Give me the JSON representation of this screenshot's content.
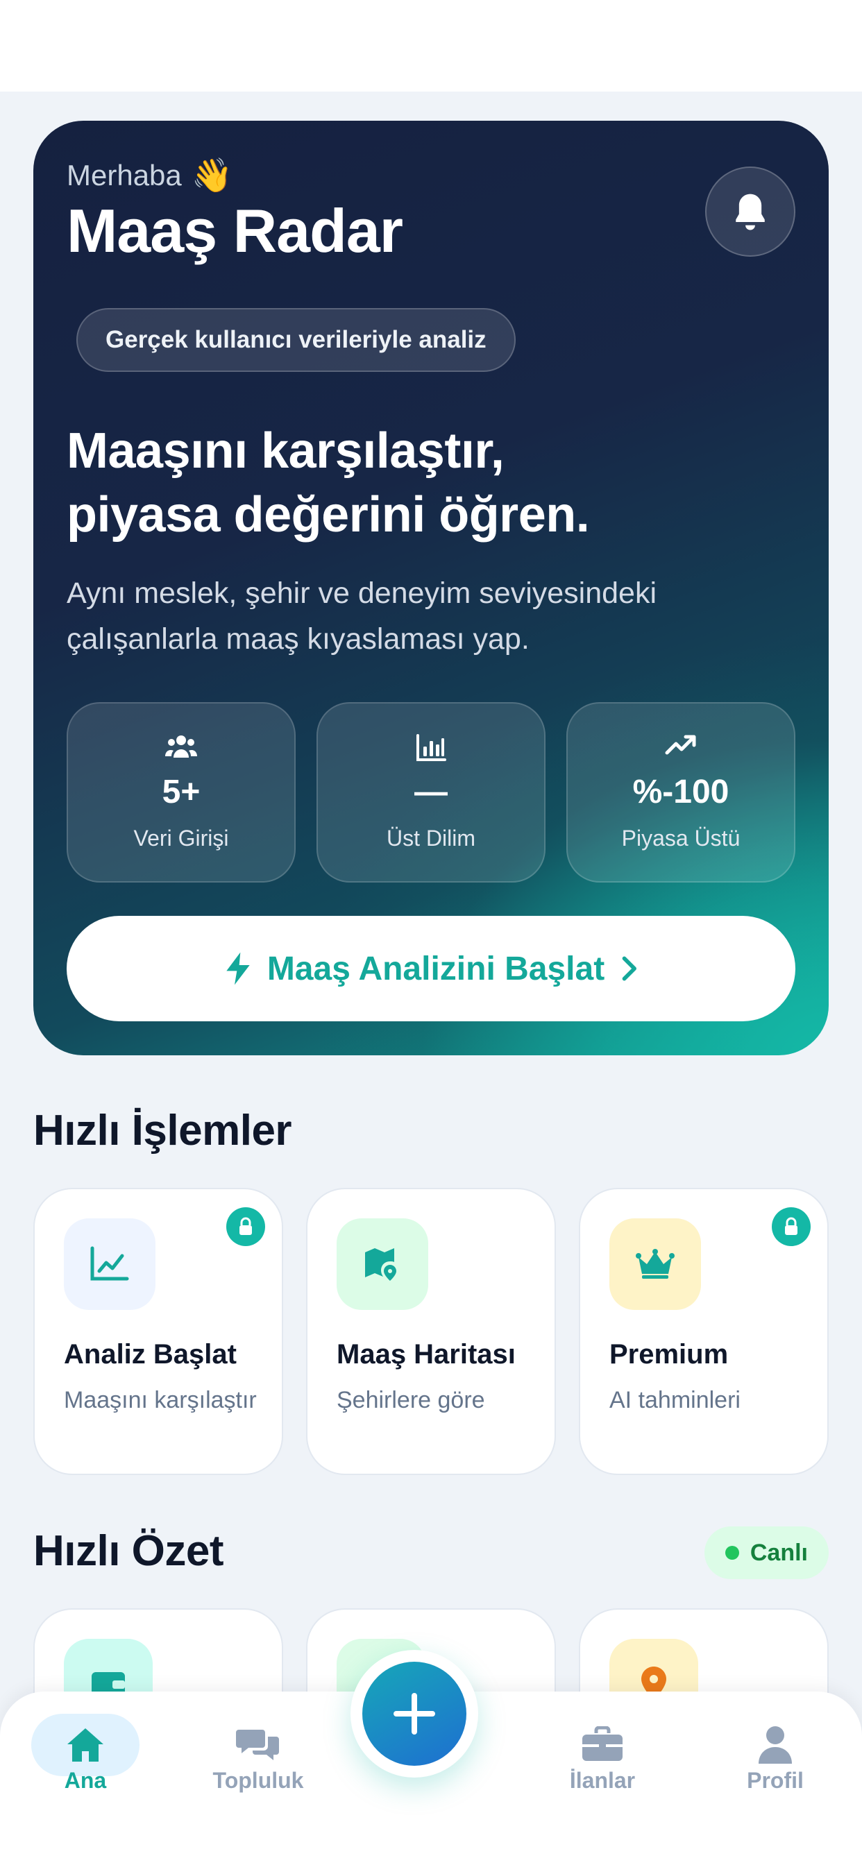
{
  "hero": {
    "greeting": "Merhaba",
    "wave_emoji": "👋",
    "title": "Maaş Radar",
    "badge": "Gerçek kullanıcı verileriyle analiz",
    "headline_line1": "Maaşını karşılaştır,",
    "headline_line2": "piyasa değerini öğren.",
    "subtitle_line1": "Aynı meslek, şehir ve deneyim seviyesindeki",
    "subtitle_line2": "çalışanlarla maaş kıyaslaması yap.",
    "stats": [
      {
        "icon": "users-icon",
        "value": "5+",
        "label": "Veri Girişi"
      },
      {
        "icon": "bar-chart-icon",
        "value": "—",
        "label": "Üst Dilim"
      },
      {
        "icon": "trending-up-icon",
        "value": "%-100",
        "label": "Piyasa Üstü"
      }
    ],
    "cta_label": "Maaş Analizini Başlat"
  },
  "quick_actions": {
    "title": "Hızlı İşlemler",
    "items": [
      {
        "icon": "line-chart-icon",
        "title": "Analiz Başlat",
        "desc": "Maaşını karşılaştır",
        "locked": true,
        "tile_color": "#eef4ff"
      },
      {
        "icon": "map-pin-icon",
        "title": "Maaş Haritası",
        "desc": "Şehirlere göre",
        "locked": false,
        "tile_color": "#dcfce7"
      },
      {
        "icon": "crown-icon",
        "title": "Premium",
        "desc": "AI tahminleri",
        "locked": true,
        "tile_color": "#fef3c7"
      }
    ]
  },
  "summary": {
    "title": "Hızlı Özet",
    "live_label": "Canlı"
  },
  "tabbar": {
    "tabs": [
      {
        "icon": "home-icon",
        "label": "Ana",
        "active": true
      },
      {
        "icon": "chat-icon",
        "label": "Topluluk",
        "active": false
      },
      {
        "icon": "briefcase-icon",
        "label": "İlanlar",
        "active": false
      },
      {
        "icon": "user-icon",
        "label": "Profil",
        "active": false
      }
    ]
  },
  "colors": {
    "accent": "#14b8a6",
    "accent_text": "#14a89a",
    "hero_dark": "#152140",
    "tab_inactive": "#94a3b8",
    "live_green": "#22c55e"
  }
}
